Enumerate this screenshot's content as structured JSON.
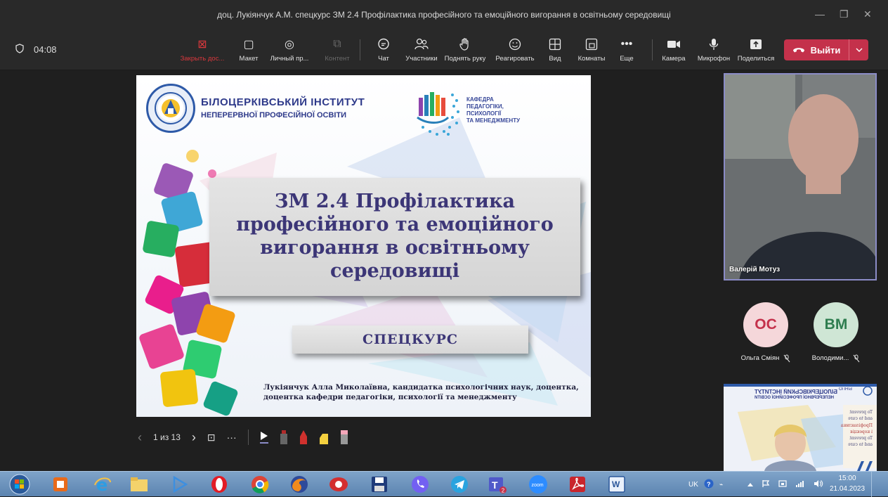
{
  "window": {
    "title": "доц. Лукіянчук А.М. спецкурс ЗМ 2.4 Профілактика професійного та емоційного вигорання в освітньому середовищі",
    "minimize": "—",
    "maximize": "❐",
    "close": "✕"
  },
  "toolbar": {
    "timer": "04:08",
    "buttons": [
      {
        "label": "Закрыть дос...",
        "icon": "close-share-icon",
        "glyph": "⊠"
      },
      {
        "label": "Макет",
        "icon": "layout-icon",
        "glyph": "▢"
      },
      {
        "label": "Личный пр...",
        "icon": "private-view-icon",
        "glyph": "◎"
      },
      {
        "label": "Контент",
        "icon": "content-icon",
        "glyph": "⧉"
      },
      {
        "label": "Чат",
        "icon": "chat-icon",
        "glyph": "💬"
      },
      {
        "label": "Участники",
        "icon": "participants-icon",
        "glyph": "👥"
      },
      {
        "label": "Поднять руку",
        "icon": "raise-hand-icon",
        "glyph": "✋"
      },
      {
        "label": "Реагировать",
        "icon": "react-icon",
        "glyph": "☺"
      },
      {
        "label": "Вид",
        "icon": "view-icon",
        "glyph": "⊞"
      },
      {
        "label": "Комнаты",
        "icon": "rooms-icon",
        "glyph": "⧠"
      },
      {
        "label": "Еще",
        "icon": "more-icon",
        "glyph": "•••"
      },
      {
        "label": "Камера",
        "icon": "camera-icon",
        "glyph": "■◀"
      },
      {
        "label": "Микрофон",
        "icon": "microphone-icon",
        "glyph": "🎙"
      },
      {
        "label": "Поделиться",
        "icon": "share-icon",
        "glyph": "⬆"
      }
    ],
    "leave_label": "Выйти",
    "leave_icon": "phone-hangup-icon"
  },
  "slide": {
    "institute_line1": "БІЛОЦЕРКІВСЬКИЙ ІНСТИТУТ",
    "institute_line2": "НЕПЕРЕРВНОЇ ПРОФЕСІЙНОЇ ОСВІТИ",
    "dept_line1": "КАФЕДРА",
    "dept_line2": "ПЕДАГОГІКИ,",
    "dept_line3": "ПСИХОЛОГІЇ",
    "dept_line4": "ТА МЕНЕДЖМЕНТУ",
    "title": "ЗМ 2.4 Профілактика професійного та емоційного вигорання в освітньому середовищі",
    "subtitle": "СПЕЦКУРС",
    "author": "Лукіянчук Алла Миколаївна, кандидатка психологічних наук, доцентка, доцентка кафедри педагогіки, психології та менеджменту"
  },
  "slide_controls": {
    "prev": "‹",
    "page": "1 из 13",
    "next": "›",
    "grid_icon": "⊡",
    "more": "···"
  },
  "participants": {
    "video_name": "Валерій Мотуз",
    "tiles": [
      {
        "initials": "ОС",
        "name": "Ольга Сміян",
        "bg": "#f5d7da",
        "fg": "#c4314b"
      },
      {
        "initials": "ВМ",
        "name": "Володими...",
        "bg": "#cfe6d5",
        "fg": "#2e7d4f"
      }
    ],
    "mic_off_glyph": "🎙̸"
  },
  "thumbnail": {
    "inst_line1": "БІЛОЦЕРКІВСЬКИЙ ІНСТИТУТ",
    "inst_line2": "НЕПЕРЕРВНОЇ ПРОФЕСІЙНОЇ ОСВІТИ",
    "logo_text": "БІНПО",
    "notes": [
      "To prevent",
      "and to cure",
      "Профілактика",
      "і корекція",
      "To prevent",
      "and to cure"
    ]
  },
  "taskbar": {
    "lang": "UK",
    "time": "15:00",
    "date": "21.04.2023"
  },
  "colors": {
    "accent": "#8b8cc7",
    "leave": "#c4314b",
    "title_text": "#3c3677"
  }
}
